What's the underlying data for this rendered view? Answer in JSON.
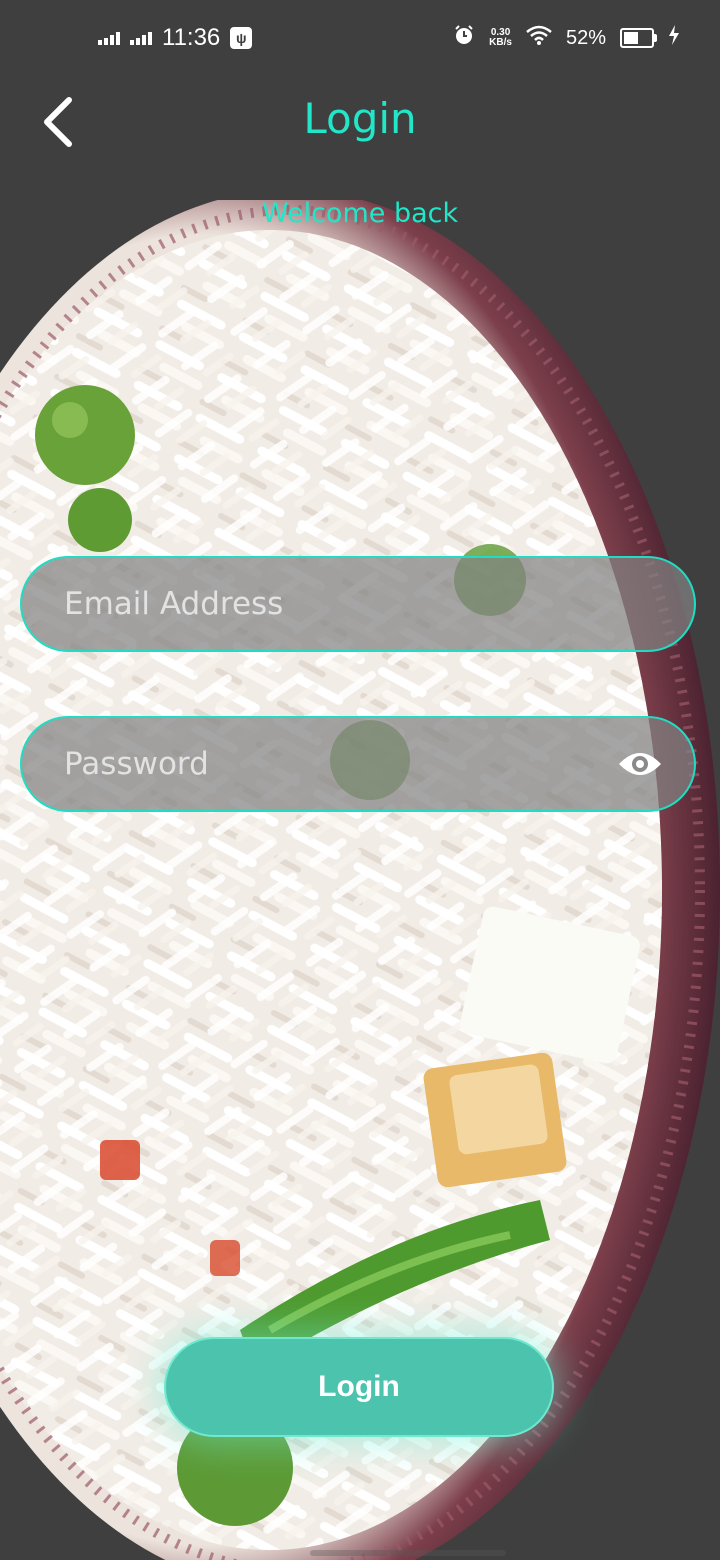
{
  "status_bar": {
    "time": "11:36",
    "speed_value": "0.30",
    "speed_unit": "KB/s",
    "battery_percent_text": "52%",
    "battery_level": 0.52,
    "icons": [
      "signal-icon",
      "signal-icon",
      "usb-icon",
      "alarm-icon",
      "wifi-icon",
      "battery-icon",
      "charging-icon"
    ]
  },
  "header": {
    "title": "Login",
    "back_icon": "chevron-left-icon",
    "subtitle": "Welcome back"
  },
  "form": {
    "email_placeholder": "Email Address",
    "email_value": "",
    "password_placeholder": "Password",
    "password_value": "",
    "password_toggle_icon": "eye-icon",
    "submit_label": "Login"
  },
  "colors": {
    "accent": "#21e6c8",
    "background": "#3f3f3f",
    "button": "#4cc3ad",
    "field_border": "#20dcc3"
  }
}
